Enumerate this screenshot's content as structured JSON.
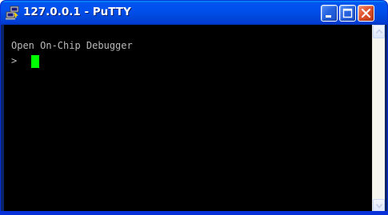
{
  "window": {
    "title": "127.0.0.1 - PuTTY",
    "icon": "putty-computers-icon"
  },
  "titlebar_buttons": {
    "minimize": "minimize-icon",
    "maximize": "maximize-icon",
    "close": "close-icon"
  },
  "terminal": {
    "lines": [
      "Open On-Chip Debugger",
      ">"
    ],
    "text_color": "#bbbbbb",
    "background": "#000000",
    "cursor_color": "#00ff00"
  },
  "scrollbar": {
    "up_icon": "scroll-up-arrow-icon",
    "down_icon": "scroll-down-arrow-icon"
  },
  "colors": {
    "titlebar": "#0050ee",
    "close_button": "#e0532e"
  }
}
